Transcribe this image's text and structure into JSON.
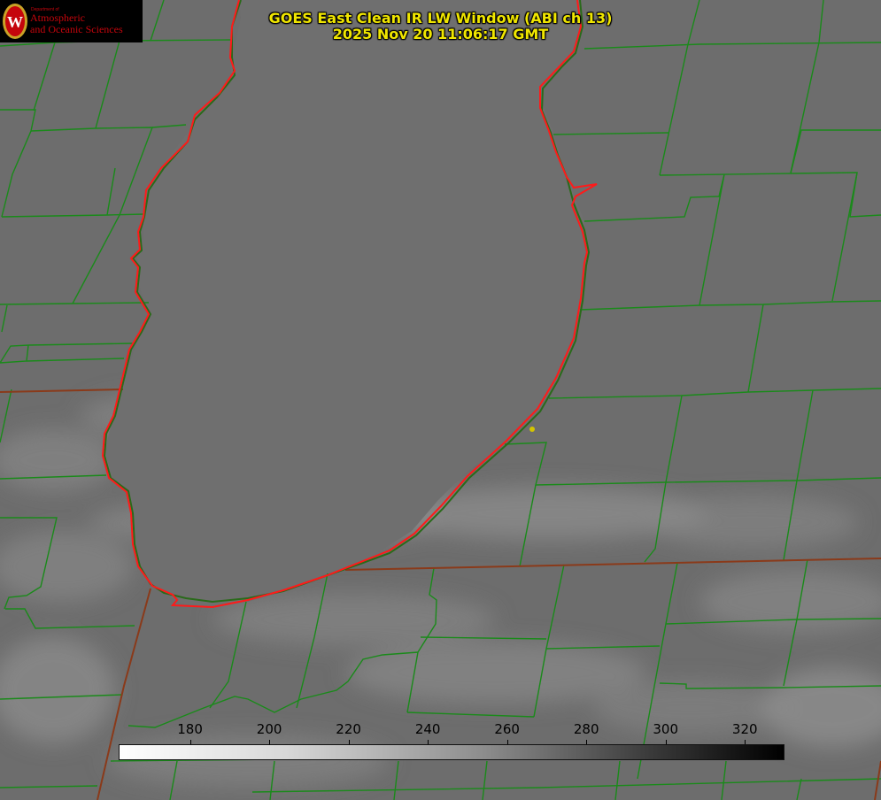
{
  "title": {
    "line1": "GOES East Clean IR LW Window (ABI ch 13)",
    "line2": "2025 Nov 20 11:06:17 GMT"
  },
  "logo": {
    "department": "Department of",
    "line1": "Atmospheric",
    "line2": "and Oceanic Sciences",
    "icon": "uw-crest-icon",
    "crest_letter": "W"
  },
  "colorbar": {
    "ticks": [
      "180",
      "200",
      "220",
      "240",
      "260",
      "280",
      "300",
      "320"
    ],
    "tick_values": [
      180,
      200,
      220,
      240,
      260,
      280,
      300,
      320
    ],
    "range": [
      162,
      330
    ],
    "low_color": "#ffffff",
    "high_color": "#000000"
  },
  "colors": {
    "lake_outline": "#ff1a1a",
    "county_lines": "#1a8a1a",
    "state_lines": "#8a3a1a",
    "background_gray": "#6e6e6e",
    "title_text": "#f0e600",
    "marker": "#d4c400"
  }
}
